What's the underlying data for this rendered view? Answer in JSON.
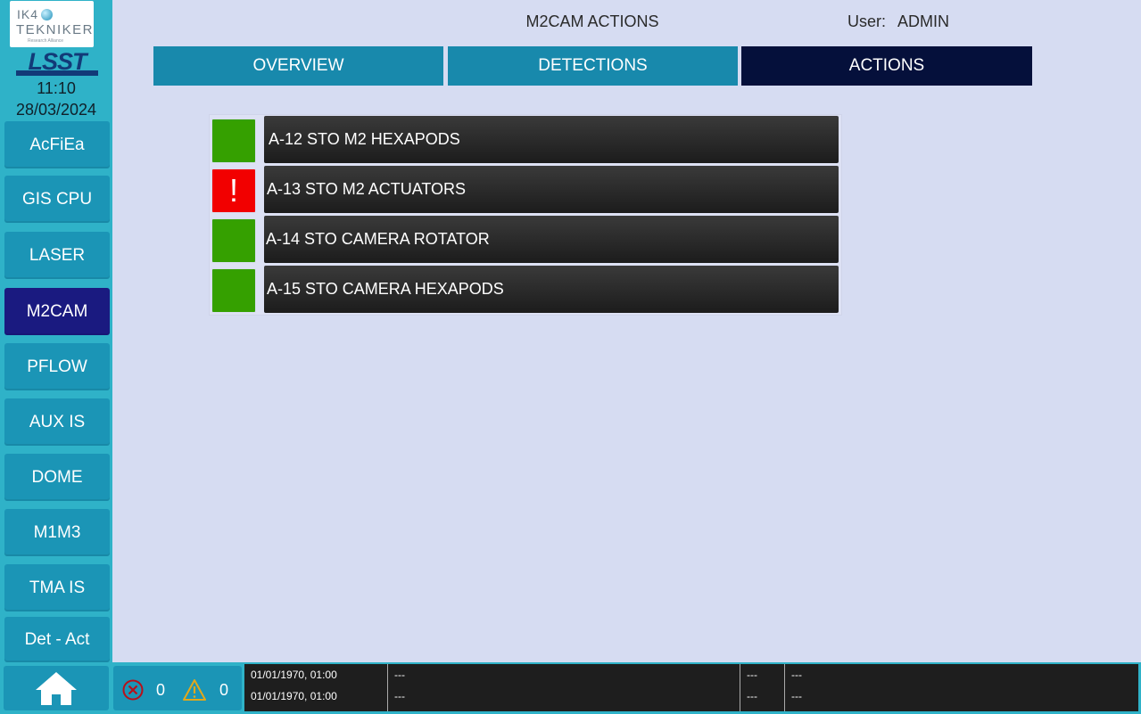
{
  "brand": {
    "partner_logo_text": "IK4",
    "partner_logo_text2": "TEKNIKER",
    "partner_logo_tagline": "Research Alliance",
    "telescope_logo_text": "LSST"
  },
  "clock": {
    "time": "11:10",
    "date": "28/03/2024"
  },
  "header": {
    "title": "M2CAM ACTIONS",
    "user_label": "User:",
    "user_name": "ADMIN"
  },
  "tabs": [
    {
      "label": "OVERVIEW"
    },
    {
      "label": "DETECTIONS"
    },
    {
      "label": "ACTIONS",
      "active": true
    }
  ],
  "sidebar": {
    "items": [
      {
        "label": "AcFiEa"
      },
      {
        "label": "GIS CPU"
      },
      {
        "label": "LASER"
      },
      {
        "label": "M2CAM",
        "active": true
      },
      {
        "label": "PFLOW"
      },
      {
        "label": "AUX IS"
      },
      {
        "label": "DOME"
      },
      {
        "label": "M1M3"
      },
      {
        "label": "TMA IS"
      },
      {
        "label": "Det - Act"
      }
    ]
  },
  "actions": [
    {
      "label": "A-12 STO M2 HEXAPODS",
      "status": "ok"
    },
    {
      "label": "A-13 STO M2 ACTUATORS",
      "status": "alarm",
      "symbol": "!"
    },
    {
      "label": "A-14 STO CAMERA ROTATOR",
      "status": "ok"
    },
    {
      "label": "A-15 STO CAMERA HEXAPODS",
      "status": "ok"
    }
  ],
  "status_bar": {
    "alarm_count": "0",
    "warning_count": "0",
    "events": [
      {
        "timestamp": "01/01/1970, 01:00",
        "message": "---",
        "code": "---",
        "detail": "---"
      },
      {
        "timestamp": "01/01/1970, 01:00",
        "message": "---",
        "code": "---",
        "detail": "---"
      }
    ]
  },
  "colors": {
    "background": "#d6dcf2",
    "sidebar": "#2fb2c8",
    "nav_button": "#1b95b6",
    "nav_active": "#1a1a80",
    "tab": "#1889ac",
    "tab_active": "#05103b",
    "status_ok": "#35a000",
    "status_alarm": "#f20000",
    "action_button": "#262626"
  },
  "icons": {
    "home": "home-icon",
    "alarm": "alarm-x-circle-icon",
    "warning": "warning-triangle-icon"
  }
}
